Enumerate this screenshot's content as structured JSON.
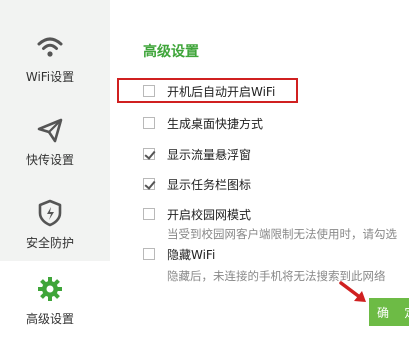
{
  "sidebar": {
    "items": [
      {
        "label": "WiFi设置",
        "icon": "wifi-icon"
      },
      {
        "label": "快传设置",
        "icon": "send-icon"
      },
      {
        "label": "安全防护",
        "icon": "shield-icon"
      },
      {
        "label": "高级设置",
        "icon": "gear-icon",
        "active": true
      }
    ]
  },
  "main": {
    "title": "高级设置",
    "options": [
      {
        "label": "开机后自动开启WiFi",
        "checked": false
      },
      {
        "label": "生成桌面快捷方式",
        "checked": false
      },
      {
        "label": "显示流量悬浮窗",
        "checked": true
      },
      {
        "label": "显示任务栏图标",
        "checked": true
      },
      {
        "label": "开启校园网模式",
        "checked": false,
        "description": "当受到校园网客户端限制无法使用时，请勾选"
      },
      {
        "label": "隐藏WiFi",
        "checked": false,
        "description": "隐藏后，未连接的手机将无法搜索到此网络"
      }
    ],
    "confirm_label": "确 定"
  },
  "colors": {
    "accent": "#3fa53a",
    "button": "#6dbb45",
    "highlight": "#d02020",
    "sidebar_bg": "#f2f3f2"
  }
}
